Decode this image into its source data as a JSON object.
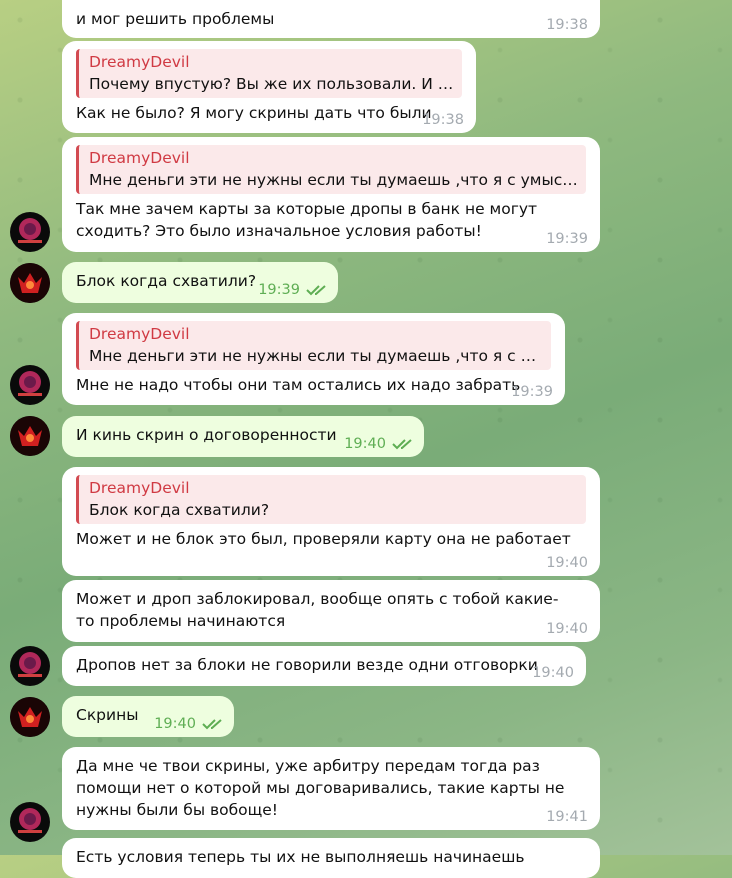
{
  "quote_name": "DreamyDevil",
  "messages": [
    {
      "text": "и мог решить проблемы",
      "time": "19:38"
    },
    {
      "quote": "Почему впустую? Вы же их пользовали. И у н...",
      "text": "Как не было? Я могу скрины дать что были",
      "time": "19:38"
    },
    {
      "quote": "Мне деньги эти не нужны если ты думаешь ,что я с умыслом....",
      "text": "Так мне зачем карты за которые дропы в банк не могут сходить? Это было изначальное условия работы!",
      "time": "19:39"
    },
    {
      "text": "Блок когда схватили?",
      "time": "19:39",
      "outgoing": true
    },
    {
      "quote": "Мне деньги эти не нужны если ты думаешь ,что я с умыс...",
      "text": "Мне не надо чтобы они там остались их надо забрать",
      "time": "19:39"
    },
    {
      "text": "И кинь скрин о договоренности",
      "time": "19:40",
      "outgoing": true
    },
    {
      "quote": "Блок когда схватили?",
      "text": "Может и не блок это был,  проверяли карту она не работает",
      "time": "19:40"
    },
    {
      "text": "Может и дроп заблокировал, вообще опять с тобой какие-то проблемы начинаются",
      "time": "19:40"
    },
    {
      "text": "Дропов нет за блоки не говорили везде одни отговорки",
      "time": "19:40"
    },
    {
      "text": "Скрины",
      "time": "19:40",
      "outgoing": true
    },
    {
      "text": "Да мне че твои скрины, уже арбитру передам тогда раз помощи нет о которой мы договаривались, такие карты не нужны были бы вобоще!",
      "time": "19:41"
    },
    {
      "text": "Есть условия теперь ты их не выполняешь начинаешь",
      "time": ""
    }
  ],
  "colors": {
    "incoming_bg": "#ffffff",
    "outgoing_bg": "#eefedf",
    "quote_accent": "#d24a51",
    "read_check": "#5fae54"
  },
  "icons": {
    "read_receipt": "double-check-icon"
  }
}
